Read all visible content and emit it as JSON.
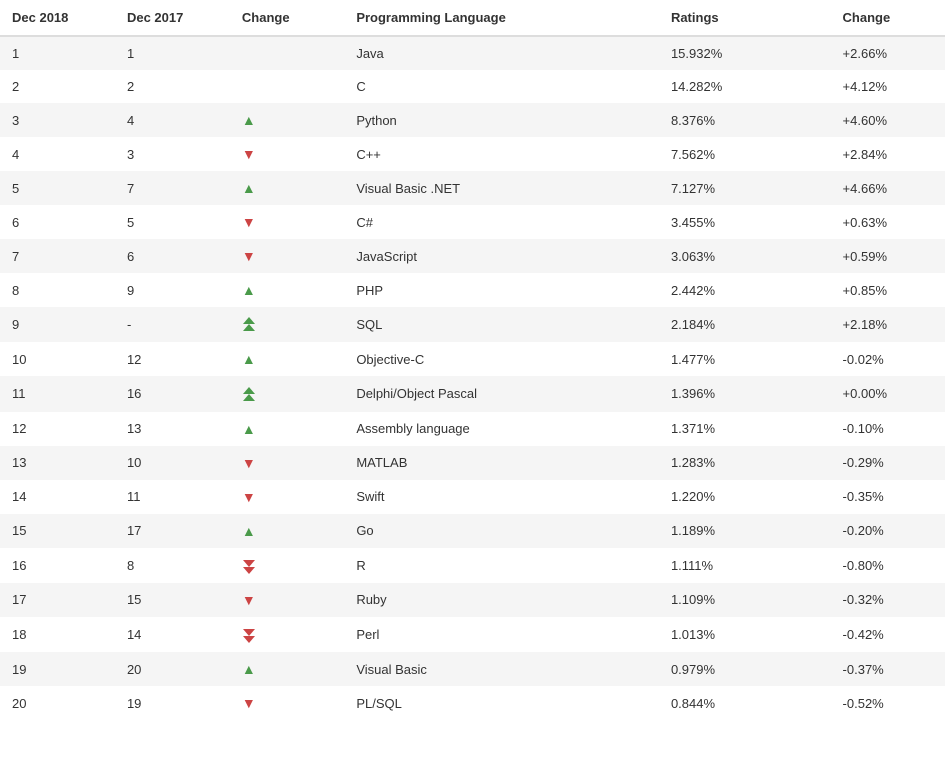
{
  "table": {
    "headers": [
      "Dec 2018",
      "Dec 2017",
      "Change",
      "Programming Language",
      "Ratings",
      "Change"
    ],
    "rows": [
      {
        "dec2018": "1",
        "dec2017": "1",
        "change_icon": "none",
        "language": "Java",
        "ratings": "15.932%",
        "change": "+2.66%"
      },
      {
        "dec2018": "2",
        "dec2017": "2",
        "change_icon": "none",
        "language": "C",
        "ratings": "14.282%",
        "change": "+4.12%"
      },
      {
        "dec2018": "3",
        "dec2017": "4",
        "change_icon": "up",
        "language": "Python",
        "ratings": "8.376%",
        "change": "+4.60%"
      },
      {
        "dec2018": "4",
        "dec2017": "3",
        "change_icon": "down",
        "language": "C++",
        "ratings": "7.562%",
        "change": "+2.84%"
      },
      {
        "dec2018": "5",
        "dec2017": "7",
        "change_icon": "up",
        "language": "Visual Basic .NET",
        "ratings": "7.127%",
        "change": "+4.66%"
      },
      {
        "dec2018": "6",
        "dec2017": "5",
        "change_icon": "down",
        "language": "C#",
        "ratings": "3.455%",
        "change": "+0.63%"
      },
      {
        "dec2018": "7",
        "dec2017": "6",
        "change_icon": "down",
        "language": "JavaScript",
        "ratings": "3.063%",
        "change": "+0.59%"
      },
      {
        "dec2018": "8",
        "dec2017": "9",
        "change_icon": "up",
        "language": "PHP",
        "ratings": "2.442%",
        "change": "+0.85%"
      },
      {
        "dec2018": "9",
        "dec2017": "-",
        "change_icon": "up-double",
        "language": "SQL",
        "ratings": "2.184%",
        "change": "+2.18%"
      },
      {
        "dec2018": "10",
        "dec2017": "12",
        "change_icon": "up",
        "language": "Objective-C",
        "ratings": "1.477%",
        "change": "-0.02%"
      },
      {
        "dec2018": "11",
        "dec2017": "16",
        "change_icon": "up-double",
        "language": "Delphi/Object Pascal",
        "ratings": "1.396%",
        "change": "+0.00%"
      },
      {
        "dec2018": "12",
        "dec2017": "13",
        "change_icon": "up",
        "language": "Assembly language",
        "ratings": "1.371%",
        "change": "-0.10%"
      },
      {
        "dec2018": "13",
        "dec2017": "10",
        "change_icon": "down",
        "language": "MATLAB",
        "ratings": "1.283%",
        "change": "-0.29%"
      },
      {
        "dec2018": "14",
        "dec2017": "11",
        "change_icon": "down",
        "language": "Swift",
        "ratings": "1.220%",
        "change": "-0.35%"
      },
      {
        "dec2018": "15",
        "dec2017": "17",
        "change_icon": "up",
        "language": "Go",
        "ratings": "1.189%",
        "change": "-0.20%"
      },
      {
        "dec2018": "16",
        "dec2017": "8",
        "change_icon": "down-double",
        "language": "R",
        "ratings": "1.111%",
        "change": "-0.80%"
      },
      {
        "dec2018": "17",
        "dec2017": "15",
        "change_icon": "down",
        "language": "Ruby",
        "ratings": "1.109%",
        "change": "-0.32%"
      },
      {
        "dec2018": "18",
        "dec2017": "14",
        "change_icon": "down-double",
        "language": "Perl",
        "ratings": "1.013%",
        "change": "-0.42%"
      },
      {
        "dec2018": "19",
        "dec2017": "20",
        "change_icon": "up",
        "language": "Visual Basic",
        "ratings": "0.979%",
        "change": "-0.37%"
      },
      {
        "dec2018": "20",
        "dec2017": "19",
        "change_icon": "down",
        "language": "PL/SQL",
        "ratings": "0.844%",
        "change": "-0.52%"
      }
    ]
  }
}
